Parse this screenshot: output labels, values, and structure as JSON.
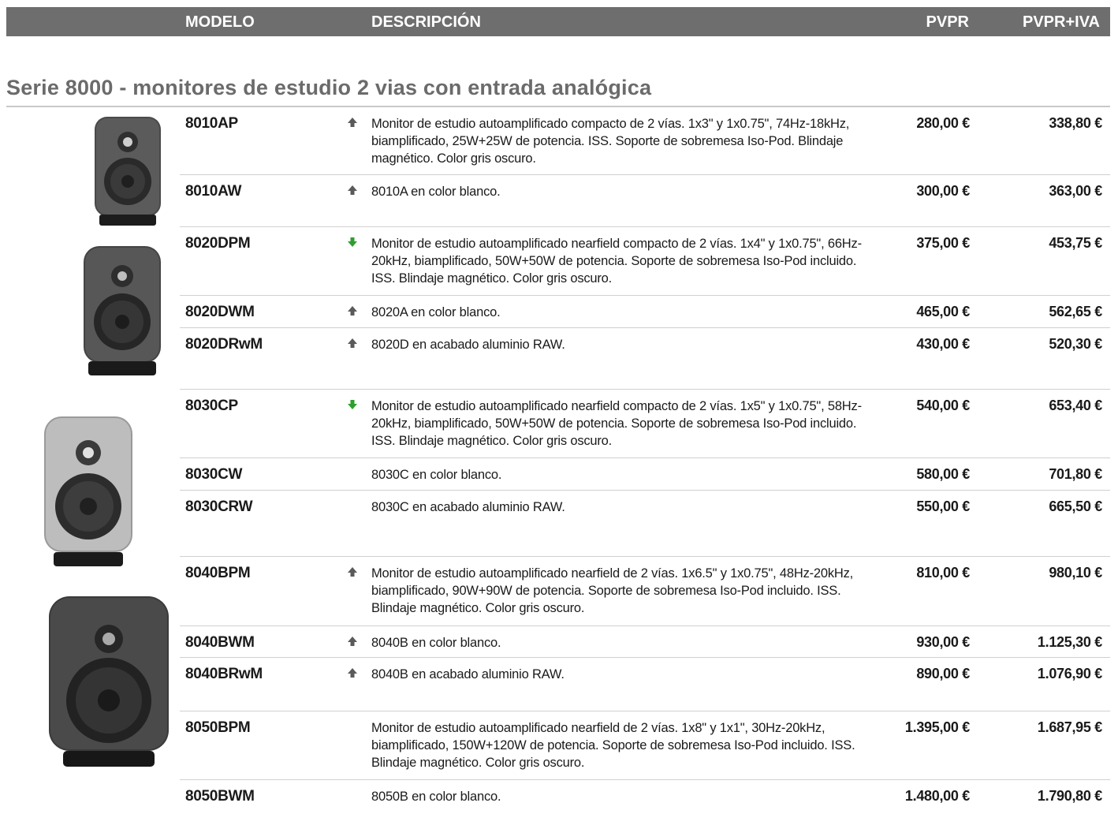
{
  "header": {
    "model": "MODELO",
    "description": "DESCRIPCIÓN",
    "pvpr": "PVPR",
    "pvpr_iva": "PVPR+IVA"
  },
  "section": {
    "title": "Serie 8000 - monitores de estudio 2 vias con entrada analógica"
  },
  "colors": {
    "header_bg": "#6e6e6e",
    "title": "#6b6b6b",
    "arrow_up": "#5a5a5a",
    "arrow_down": "#2e9e2e"
  },
  "rows": [
    {
      "model": "8010AP",
      "arrow": "up-arrow-icon",
      "desc": "Monitor de estudio autoamplificado compacto de 2 vías. 1x3\" y 1x0.75\", 74Hz-18kHz, biamplificado, 25W+25W de potencia. ISS. Soporte de sobremesa Iso-Pod. Blindaje magnético. Color gris oscuro.",
      "pvpr": "280,00 €",
      "pvpr_iva": "338,80 €"
    },
    {
      "model": "8010AW",
      "arrow": "up-arrow-icon",
      "desc": "8010A en color blanco.",
      "pvpr": "300,00 €",
      "pvpr_iva": "363,00 €"
    },
    {
      "model": "8020DPM",
      "arrow": "down-arrow-icon",
      "desc": "Monitor de estudio autoamplificado nearfield compacto de 2 vías. 1x4\" y 1x0.75\", 66Hz-20kHz, biamplificado, 50W+50W de potencia. Soporte de sobremesa Iso-Pod incluido. ISS. Blindaje magnético. Color gris oscuro.",
      "pvpr": "375,00 €",
      "pvpr_iva": "453,75 €"
    },
    {
      "model": "8020DWM",
      "arrow": "up-arrow-icon",
      "desc": "8020A en color blanco.",
      "pvpr": "465,00 €",
      "pvpr_iva": "562,65 €"
    },
    {
      "model": "8020DRwM",
      "arrow": "up-arrow-icon",
      "desc": "8020D en acabado aluminio RAW.",
      "pvpr": "430,00 €",
      "pvpr_iva": "520,30 €"
    },
    {
      "model": "8030CP",
      "arrow": "down-arrow-icon",
      "desc": "Monitor de estudio autoamplificado nearfield compacto de 2 vías. 1x5\" y 1x0.75\", 58Hz-20kHz, biamplificado, 50W+50W de potencia. Soporte de sobremesa Iso-Pod incluido. ISS. Blindaje magnético. Color gris oscuro.",
      "pvpr": "540,00 €",
      "pvpr_iva": "653,40 €"
    },
    {
      "model": "8030CW",
      "arrow": "",
      "desc": "8030C en color blanco.",
      "pvpr": "580,00 €",
      "pvpr_iva": "701,80 €"
    },
    {
      "model": "8030CRW",
      "arrow": "",
      "desc": "8030C en acabado aluminio RAW.",
      "pvpr": "550,00 €",
      "pvpr_iva": "665,50 €"
    },
    {
      "model": "8040BPM",
      "arrow": "up-arrow-icon",
      "desc": "Monitor de estudio autoamplificado nearfield de 2 vías. 1x6.5\" y 1x0.75\", 48Hz-20kHz, biamplificado, 90W+90W de potencia. Soporte de sobremesa Iso-Pod incluido. ISS. Blindaje magnético. Color gris oscuro.",
      "pvpr": "810,00 €",
      "pvpr_iva": "980,10 €"
    },
    {
      "model": "8040BWM",
      "arrow": "up-arrow-icon",
      "desc": "8040B en color blanco.",
      "pvpr": "930,00 €",
      "pvpr_iva": "1.125,30 €"
    },
    {
      "model": "8040BRwM",
      "arrow": "up-arrow-icon",
      "desc": "8040B en acabado aluminio RAW.",
      "pvpr": "890,00 €",
      "pvpr_iva": "1.076,90 €"
    },
    {
      "model": "8050BPM",
      "arrow": "",
      "desc": "Monitor de estudio autoamplificado nearfield de 2 vías. 1x8\" y 1x1\", 30Hz-20kHz, biamplificado, 150W+120W de potencia. Soporte de sobremesa Iso-Pod incluido. ISS. Blindaje magnético. Color gris oscuro.",
      "pvpr": "1.395,00 €",
      "pvpr_iva": "1.687,95 €"
    },
    {
      "model": "8050BWM",
      "arrow": "",
      "desc": "8050B en color blanco.",
      "pvpr": "1.480,00 €",
      "pvpr_iva": "1.790,80 €"
    }
  ],
  "speaker_images": [
    {
      "name": "speaker-8010-image",
      "finish": "dark"
    },
    {
      "name": "speaker-8020-image",
      "finish": "dark"
    },
    {
      "name": "speaker-8030-image",
      "finish": "aluminium"
    },
    {
      "name": "speaker-8040-image",
      "finish": "dark"
    }
  ]
}
